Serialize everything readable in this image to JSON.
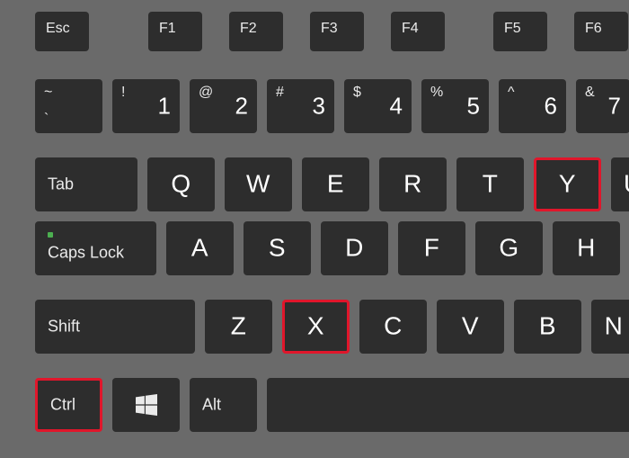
{
  "function_row": {
    "esc": "Esc",
    "f1": "F1",
    "f2": "F2",
    "f3": "F3",
    "f4": "F4",
    "f5": "F5",
    "f6": "F6"
  },
  "number_row": {
    "tilde_upper": "~",
    "tilde_lower": "`",
    "k1_upper": "!",
    "k1_main": "1",
    "k2_upper": "@",
    "k2_main": "2",
    "k3_upper": "#",
    "k3_main": "3",
    "k4_upper": "$",
    "k4_main": "4",
    "k5_upper": "%",
    "k5_main": "5",
    "k6_upper": "^",
    "k6_main": "6",
    "k7_upper": "&",
    "k7_main": "7"
  },
  "qwerty_row": {
    "tab": "Tab",
    "q": "Q",
    "w": "W",
    "e": "E",
    "r": "R",
    "t": "T",
    "y": "Y",
    "u": "U"
  },
  "home_row": {
    "caps": "Caps Lock",
    "a": "A",
    "s": "S",
    "d": "D",
    "f": "F",
    "g": "G",
    "h": "H"
  },
  "shift_row": {
    "shift": "Shift",
    "z": "Z",
    "x": "X",
    "c": "C",
    "v": "V",
    "b": "B",
    "n": "N"
  },
  "bottom_row": {
    "ctrl": "Ctrl",
    "alt": "Alt"
  },
  "highlights": [
    "y",
    "x",
    "ctrl"
  ]
}
